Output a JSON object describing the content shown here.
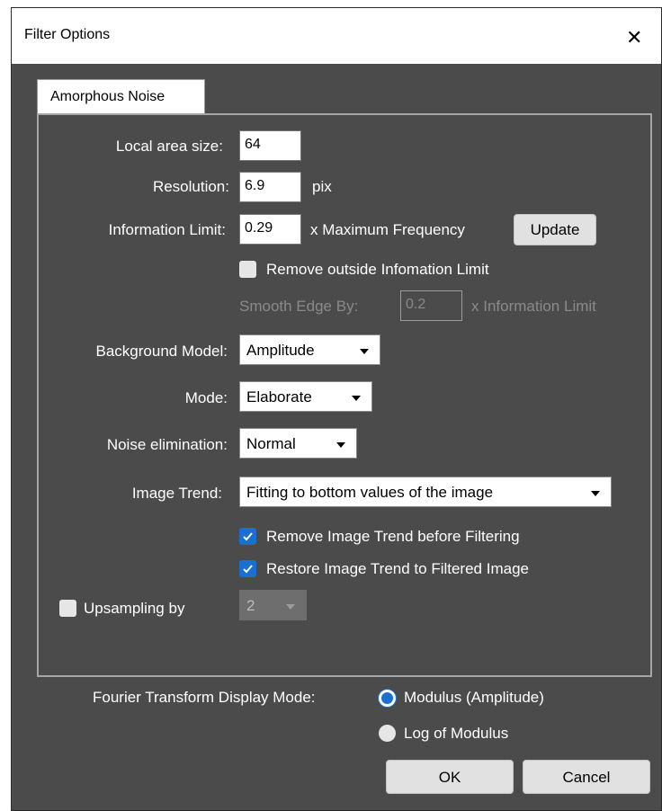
{
  "window": {
    "title": "Filter Options",
    "close_glyph": "✕"
  },
  "tab": {
    "label": "Amorphous Noise"
  },
  "local_area_size": {
    "label": "Local area size:",
    "value": "64"
  },
  "resolution": {
    "label": "Resolution:",
    "value": "6.9",
    "unit": "pix"
  },
  "information_limit": {
    "label": "Information Limit:",
    "value": "0.29",
    "unit": "x Maximum Frequency",
    "update_button": "Update"
  },
  "remove_outside": {
    "label": "Remove outside Infomation Limit",
    "checked": false
  },
  "smooth_edge": {
    "label": "Smooth Edge By:",
    "value": "0.2",
    "unit": "x Information Limit",
    "enabled": false
  },
  "background_model": {
    "label": "Background Model:",
    "value": "Amplitude"
  },
  "mode": {
    "label": "Mode:",
    "value": "Elaborate"
  },
  "noise_elimination": {
    "label": "Noise elimination:",
    "value": "Normal"
  },
  "image_trend": {
    "label": "Image Trend:",
    "value": "Fitting to bottom values of the image"
  },
  "remove_trend": {
    "label": "Remove Image Trend before Filtering",
    "checked": true
  },
  "restore_trend": {
    "label": "Restore Image Trend to Filtered Image",
    "checked": true
  },
  "upsampling": {
    "label": "Upsampling by",
    "checked": false,
    "value": "2"
  },
  "fourier": {
    "label": "Fourier Transform Display Mode:",
    "options": [
      {
        "label": "Modulus (Amplitude)",
        "selected": true
      },
      {
        "label": "Log of Modulus",
        "selected": false
      }
    ]
  },
  "buttons": {
    "ok": "OK",
    "cancel": "Cancel"
  },
  "colors": {
    "background": "#4b4b4b",
    "accent": "#1b6fd1",
    "panel_border": "#a6a6a6"
  }
}
